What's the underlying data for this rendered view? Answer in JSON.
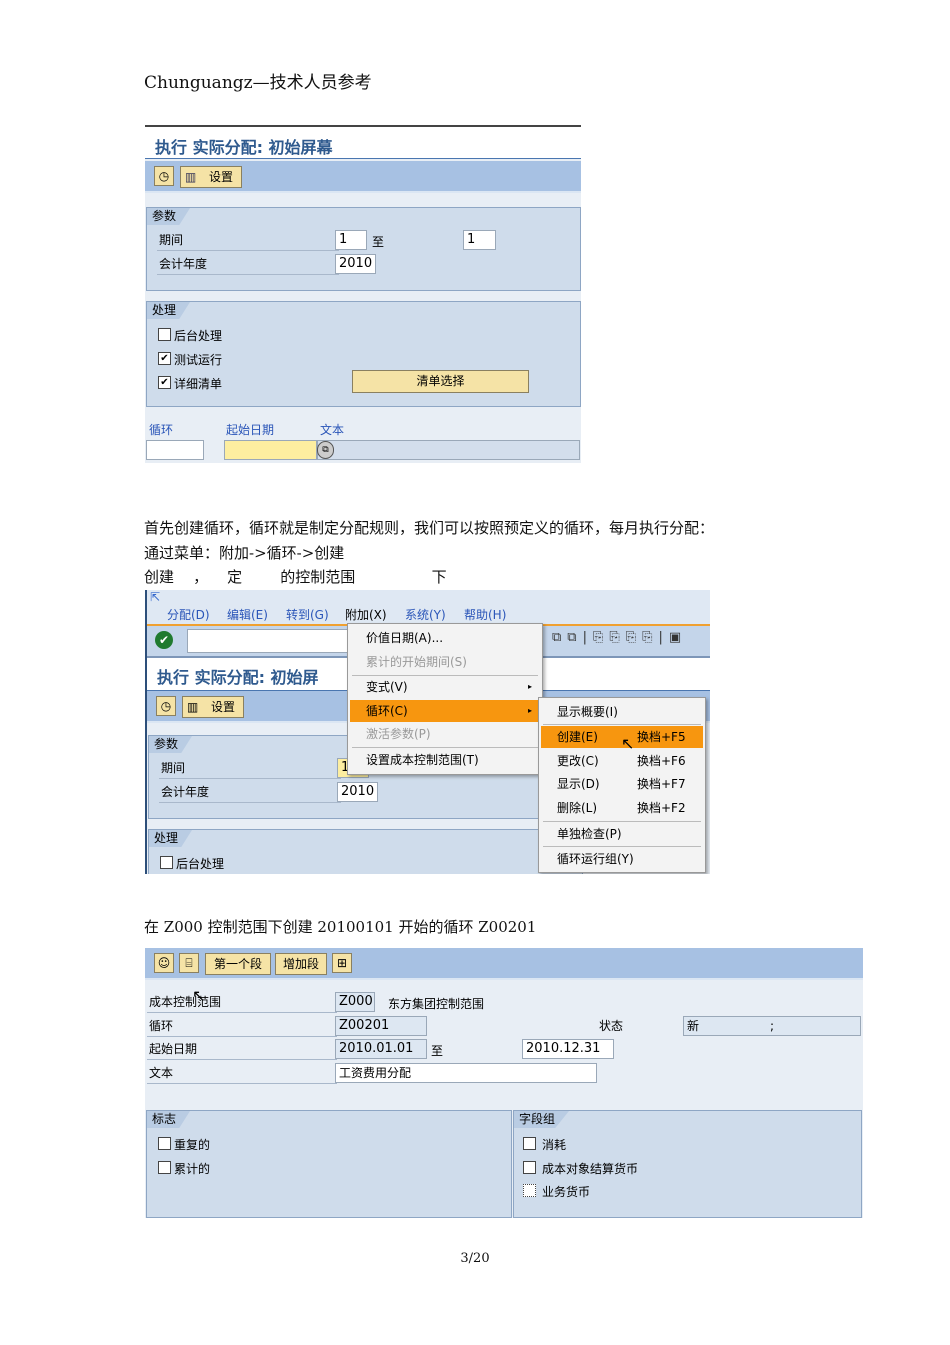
{
  "header": "Chunguangz—技术人员参考",
  "s1": {
    "title": "执行 实际分配: 初始屏幕",
    "settings": "设置",
    "params": {
      "tab": "参数",
      "period_label": "期间",
      "period_from": "1",
      "to": "至",
      "period_to": "1",
      "year_label": "会计年度",
      "year": "2010"
    },
    "proc": {
      "tab": "处理",
      "background": "后台处理",
      "test_run": "测试运行",
      "detail_list": "详细清单",
      "list_select": "清单选择"
    },
    "cols": [
      "循环",
      "起始日期",
      "文本"
    ]
  },
  "para": [
    "首先创建循环，循环就是制定分配规则，我们可以按照预定义的循环，每月执行分配：",
    "通过菜单：附加->循环->创建",
    "创建    ，    定        的控制范围                下"
  ],
  "s2": {
    "menubar": [
      "分配(D)",
      "编辑(E)",
      "转到(G)",
      "附加(X)",
      "系统(Y)",
      "帮助(H)"
    ],
    "title": "执行 实际分配: 初始屏",
    "settings": "设置",
    "params": {
      "tab": "参数",
      "period_label": "期间",
      "period_from": "1",
      "year_label": "会计年度",
      "year": "2010"
    },
    "proc": {
      "tab": "处理",
      "background": "后台处理"
    },
    "menu": [
      "价值日期(A)...",
      "累计的开始期间(S)",
      "变式(V)",
      "循环(C)",
      "激活参数(P)",
      "设置成本控制范围(T)"
    ],
    "submenu": [
      {
        "label": "显示概要(I)",
        "sc": ""
      },
      {
        "label": "创建(E)",
        "sc": "换档+F5"
      },
      {
        "label": "更改(C)",
        "sc": "换档+F6"
      },
      {
        "label": "显示(D)",
        "sc": "换档+F7"
      },
      {
        "label": "删除(L)",
        "sc": "换档+F2"
      },
      {
        "label": "单独检查(P)",
        "sc": ""
      },
      {
        "label": "循环运行组(Y)",
        "sc": ""
      }
    ]
  },
  "caption": "在 Z000 控制范围下创建 20100101 开始的循环 Z00201",
  "s3": {
    "btn_first": "第一个段",
    "btn_add": "增加段",
    "ca_label": "成本控制范围",
    "ca": "Z000",
    "ca_name": "东方集团控制范围",
    "cycle_label": "循环",
    "cycle": "Z00201",
    "status_label": "状态",
    "status": "新",
    "status_extra": ";",
    "start_label": "起始日期",
    "start": "2010.01.01",
    "to": "至",
    "end": "2010.12.31",
    "text_label": "文本",
    "text": "工资费用分配",
    "flags": {
      "tab": "标志",
      "iterative": "重复的",
      "cumulative": "累计的"
    },
    "fieldgroup": {
      "tab": "字段组",
      "consumption": "消耗",
      "co_currency": "成本对象结算货币",
      "trans_currency": "业务货币"
    }
  },
  "footer": "3/20"
}
